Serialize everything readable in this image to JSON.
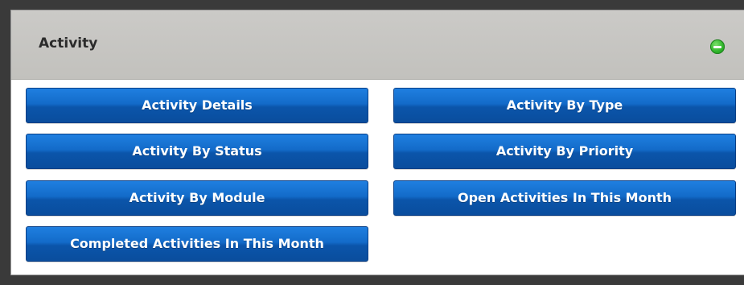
{
  "panel": {
    "title": "Activity",
    "collapse_icon": "minus-circle-icon",
    "accent_color": "#2fb52a"
  },
  "buttons": {
    "left": [
      "Activity Details",
      "Activity By Status",
      "Activity By Module",
      "Completed Activities In This Month"
    ],
    "right": [
      "Activity By Type",
      "Activity By Priority",
      "Open Activities In This Month"
    ],
    "color": "#136bc9"
  }
}
